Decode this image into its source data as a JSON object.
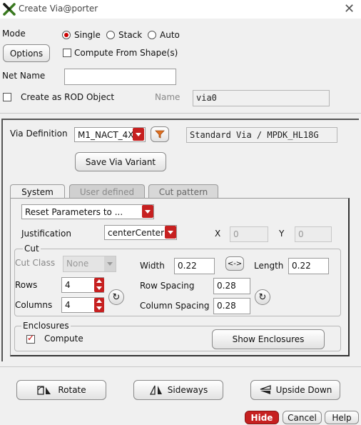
{
  "window": {
    "title": "Create Via@porter",
    "close_icon": "close-icon"
  },
  "mode": {
    "label": "Mode",
    "options": [
      "Single",
      "Stack",
      "Auto"
    ],
    "selected": "Single"
  },
  "options_button": "Options",
  "compute_from_shapes": {
    "label": "Compute From Shape(s)",
    "checked": false
  },
  "net_name": {
    "label": "Net Name",
    "value": ""
  },
  "rod": {
    "label": "Create as ROD Object",
    "checked": false,
    "name_label": "Name",
    "name_value": "via0"
  },
  "via_definition": {
    "label": "Via Definition",
    "value": "M1_NACT_4X",
    "filter_icon": "filter-icon",
    "description": "Standard Via / MPDK_HL18G"
  },
  "save_variant_button": "Save Via Variant",
  "tabs": [
    {
      "label": "System",
      "state": "active"
    },
    {
      "label": "User defined",
      "state": "disabled"
    },
    {
      "label": "Cut pattern",
      "state": "inactive"
    }
  ],
  "reset_params": {
    "value": "Reset Parameters to ..."
  },
  "justification": {
    "label": "Justification",
    "value": "centerCenter"
  },
  "x": {
    "label": "X",
    "value": "0"
  },
  "y": {
    "label": "Y",
    "value": "0"
  },
  "cut": {
    "title": "Cut",
    "cut_class_label": "Cut Class",
    "cut_class_value": "None",
    "width_label": "Width",
    "width_value": "0.22",
    "swap_label": "<->",
    "length_label": "Length",
    "length_value": "0.22",
    "rows_label": "Rows",
    "rows_value": "4",
    "columns_label": "Columns",
    "columns_value": "4",
    "row_spacing_label": "Row Spacing",
    "row_spacing_value": "0.28",
    "column_spacing_label": "Column Spacing",
    "column_spacing_value": "0.28"
  },
  "enclosures": {
    "title": "Enclosures",
    "compute_label": "Compute",
    "compute_checked": true,
    "show_button": "Show Enclosures"
  },
  "transform_buttons": {
    "rotate": "Rotate",
    "sideways": "Sideways",
    "upside_down": "Upside Down"
  },
  "footer": {
    "hide": "Hide",
    "cancel": "Cancel",
    "help": "Help"
  },
  "colors": {
    "accent_red": "#c62020",
    "filter_orange": "#e07020"
  }
}
